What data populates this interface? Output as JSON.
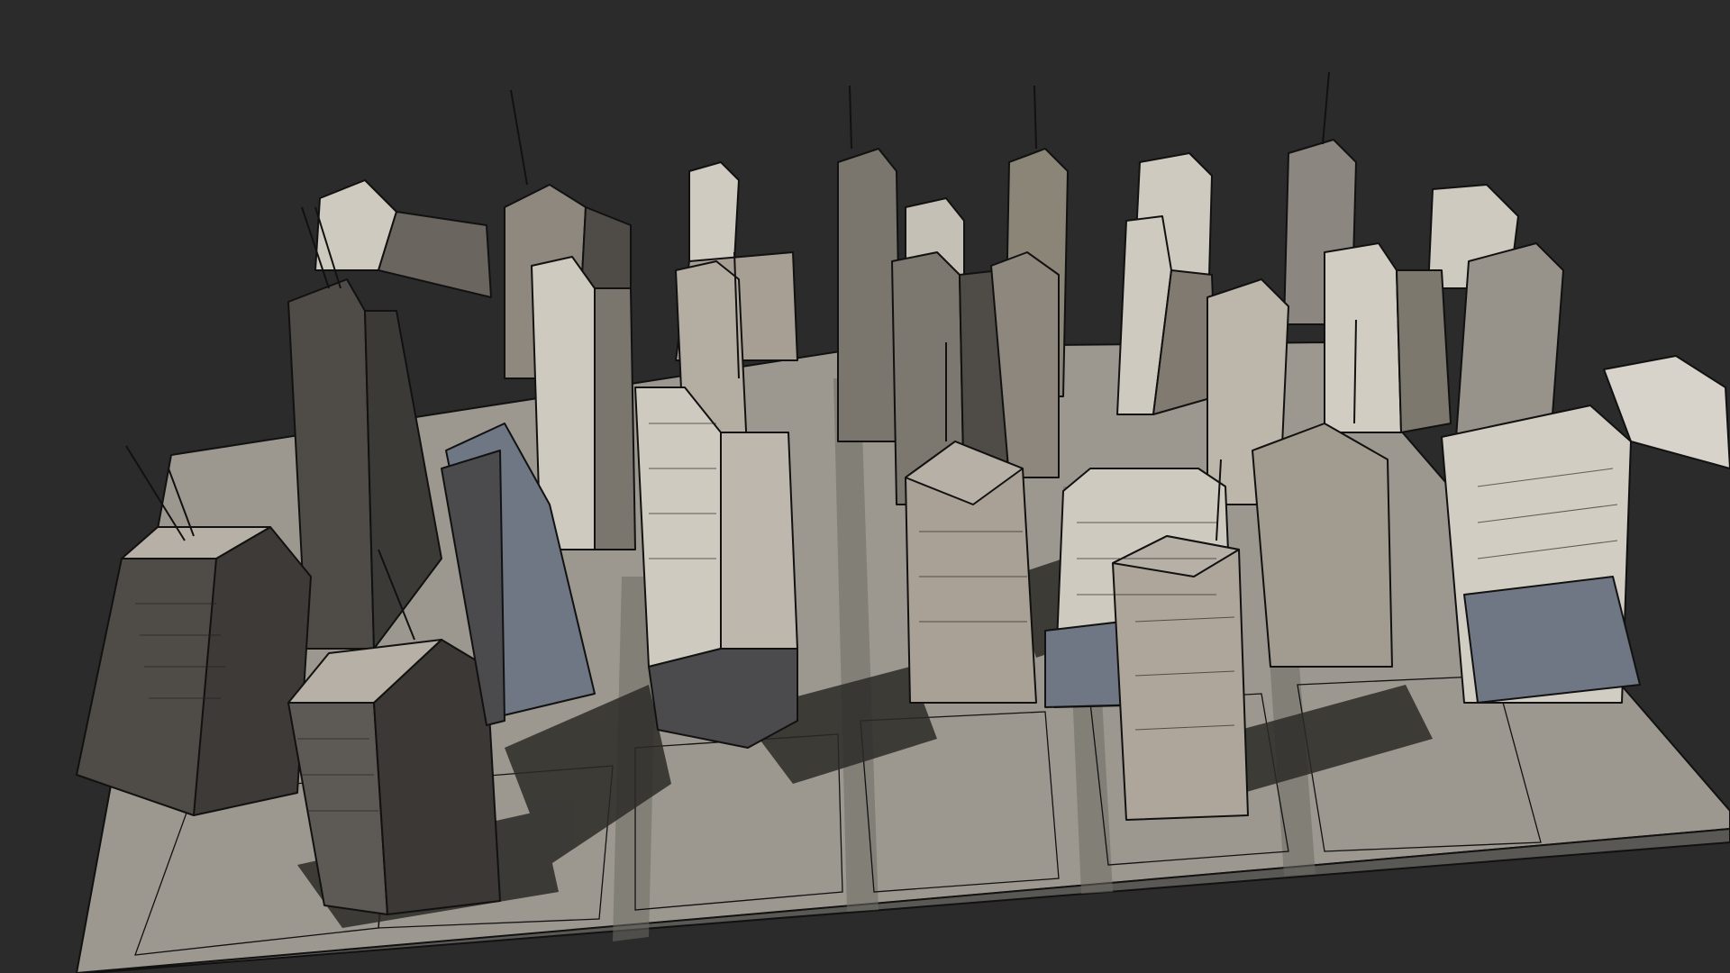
{
  "viewport": {
    "background": "#2b2b2b",
    "render_style": "sketchy-edges-textured",
    "shadows": true
  },
  "scene": {
    "subject": "city-block-model",
    "rows": 3,
    "lots_front_row": 6,
    "colors": {
      "base_slab": "#9c988f",
      "base_edge": "#5a5854",
      "pavement": "#b4ada2",
      "street": "#6e6b65",
      "shadow": "#2c2a27",
      "tower_light": "#cfcac0",
      "tower_mid": "#9f978b",
      "tower_dark": "#4f4c48",
      "glass": "#6e7783",
      "roof": "#b7b0a6",
      "antenna": "#151515"
    }
  }
}
